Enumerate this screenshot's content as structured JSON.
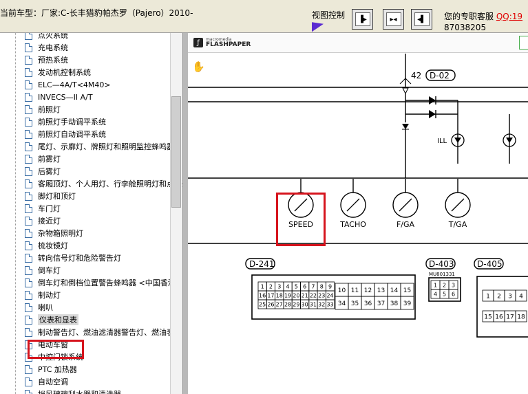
{
  "header": {
    "vehicle_label": "当前车型：厂家:C-长丰猎豹帕杰罗（Pajero）2010-",
    "view_control_label": "视图控制",
    "service_label": "您的专职客服",
    "qq_label": "QQ:19",
    "service_number": "87038205"
  },
  "tree": {
    "items": [
      {
        "label": "点火系统"
      },
      {
        "label": "充电系统"
      },
      {
        "label": "预热系统"
      },
      {
        "label": "发动机控制系统"
      },
      {
        "label": "ELC—4A/T<4M40>"
      },
      {
        "label": "INVECS—II A/T"
      },
      {
        "label": "前照灯"
      },
      {
        "label": "前照灯手动调平系统"
      },
      {
        "label": "前照灯自动调平系统"
      },
      {
        "label": "尾灯、示廓灯、牌照灯和照明监控蜂鸣器"
      },
      {
        "label": "前雾灯"
      },
      {
        "label": "后雾灯"
      },
      {
        "label": "客厢顶灯、个人用灯、行李舱照明灯和点火开关照明灯"
      },
      {
        "label": "脚灯和顶灯"
      },
      {
        "label": "车门灯"
      },
      {
        "label": "接近灯"
      },
      {
        "label": "杂物箱照明灯"
      },
      {
        "label": "梳妆镜灯"
      },
      {
        "label": "转向信号灯和危险警告灯"
      },
      {
        "label": "倒车灯"
      },
      {
        "label": "倒车灯和倒档位置警告蜂鸣器 <中国香港>"
      },
      {
        "label": "制动灯"
      },
      {
        "label": "喇叭"
      },
      {
        "label": "仪表和显表"
      },
      {
        "label": "制动警告灯、燃油滤清器警告灯、燃油表"
      },
      {
        "label": "电动车窗"
      },
      {
        "label": "中控门锁系统"
      },
      {
        "label": "PTC 加热器"
      },
      {
        "label": "自动空调"
      },
      {
        "label": "挡风玻璃刮水器和清洗器"
      }
    ]
  },
  "viewer": {
    "brand_small": "macromedia",
    "brand_large": "FLASHPAPER"
  },
  "diagram": {
    "connector_top": "D-02",
    "top_pin": "42",
    "ill_label": "ILL",
    "gauges": [
      "SPEED",
      "TACHO",
      "F/GA",
      "T/GA"
    ],
    "connector_left": "D-241",
    "connector_mid": "D-403",
    "connector_mid_part": "MU801331",
    "connector_right": "D-405",
    "pins_left": [
      "1",
      "2",
      "3",
      "4",
      "5",
      "6",
      "7",
      "8",
      "9",
      "16",
      "17",
      "18",
      "19",
      "20",
      "21",
      "22",
      "23",
      "24",
      "25",
      "26",
      "27",
      "28",
      "29",
      "30",
      "31",
      "32",
      "33"
    ],
    "pins_left_big": [
      "10",
      "11",
      "12",
      "13",
      "14",
      "15",
      "34",
      "35",
      "36",
      "37",
      "38",
      "39"
    ],
    "pins_mid": [
      "1",
      "2",
      "3",
      "4",
      "5",
      "6"
    ],
    "pins_right": [
      "1",
      "2",
      "3",
      "4",
      "15",
      "16",
      "17",
      "18"
    ]
  }
}
